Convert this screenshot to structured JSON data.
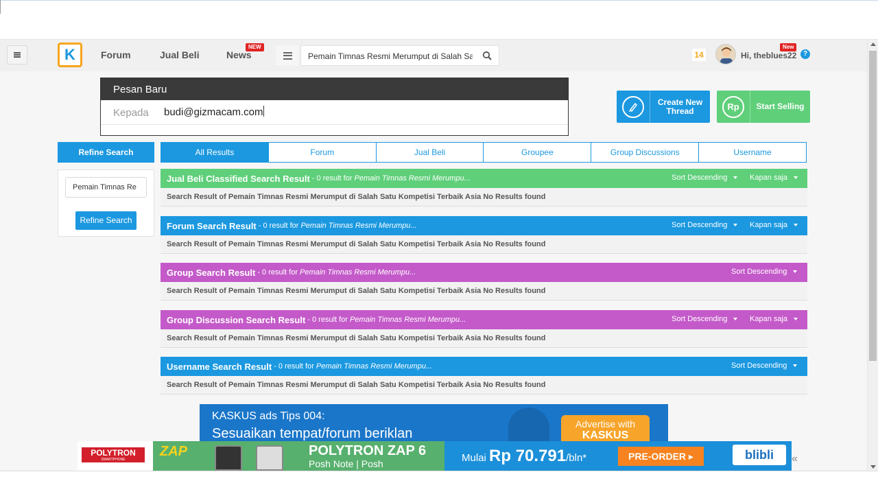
{
  "header": {
    "nav": [
      {
        "label": "Forum"
      },
      {
        "label": "Jual Beli"
      },
      {
        "label": "News",
        "badge": "NEW"
      }
    ],
    "search": {
      "value": "Pemain Timnas Resmi Merumput di Salah Sat"
    },
    "notifications": "14",
    "greeting": "Hi, theblues22",
    "greeting_badge": "New",
    "help": "?"
  },
  "logo": "K",
  "popup": {
    "title": "Pesan Baru",
    "to_label": "Kepada",
    "to_value": "budi@gizmacam.com"
  },
  "actions": {
    "create": "Create New Thread",
    "sell": "Start Selling",
    "sell_icon": "Rp"
  },
  "refine": {
    "head": "Refine Search",
    "input_value": "Pemain Timnas Re",
    "button": "Refine Search"
  },
  "tabs": [
    "All Results",
    "Forum",
    "Jual Beli",
    "Groupee",
    "Group Discussions",
    "Username"
  ],
  "sections": [
    {
      "title": "Jual Beli Classified Search Result",
      "sub": "- 0 result for",
      "query": "Pemain Timnas Resmi Merumpu...",
      "sort": "Sort Descending",
      "time": "Kapan saja",
      "body": "Search Result of Pemain Timnas Resmi Merumput di Salah Satu Kompetisi Terbaik Asia No Results found",
      "color": "#5fcf7a"
    },
    {
      "title": "Forum Search Result",
      "sub": "- 0 result for",
      "query": "Pemain Timnas Resmi Merumpu...",
      "sort": "Sort Descending",
      "time": "Kapan saja",
      "body": "Search Result of Pemain Timnas Resmi Merumput di Salah Satu Kompetisi Terbaik Asia No Results found",
      "color": "#1b98e0"
    },
    {
      "title": "Group Search Result",
      "sub": "- 0 result for",
      "query": "Pemain Timnas Resmi Merumpu...",
      "sort": "Sort Descending",
      "time": "",
      "body": "Search Result of Pemain Timnas Resmi Merumput di Salah Satu Kompetisi Terbaik Asia No Results found",
      "color": "#c45ac9"
    },
    {
      "title": "Group Discussion Search Result",
      "sub": "- 0 result for",
      "query": "Pemain Timnas Resmi Merumpu...",
      "sort": "Sort Descending",
      "time": "Kapan saja",
      "body": "Search Result of Pemain Timnas Resmi Merumput di Salah Satu Kompetisi Terbaik Asia No Results found",
      "color": "#c45ac9"
    },
    {
      "title": "Username Search Result",
      "sub": "- 0 result for",
      "query": "Pemain Timnas Resmi Merumpu...",
      "sort": "Sort Descending",
      "time": "",
      "body": "Search Result of Pemain Timnas Resmi Merumput di Salah Satu Kompetisi Terbaik Asia No Results found",
      "color": "#1b98e0"
    }
  ],
  "ad": {
    "line1": "KASKUS ads Tips 004:",
    "line2": "Sesuaikan tempat/forum beriklan",
    "advertise": "Advertise with",
    "brand": "KASKUS"
  },
  "polytron": {
    "logo": "POLYTRON",
    "logo_sub": "SMARTPHONE",
    "zap": "ZAP",
    "title": "POLYTRON ZAP 6",
    "subtitle": "Posh Note | Posh",
    "price_prefix": "Mulai",
    "price": "Rp 70.791",
    "price_suffix": "/bln*",
    "cta": "PRE-ORDER",
    "partner": "blibli",
    "close": "«"
  }
}
